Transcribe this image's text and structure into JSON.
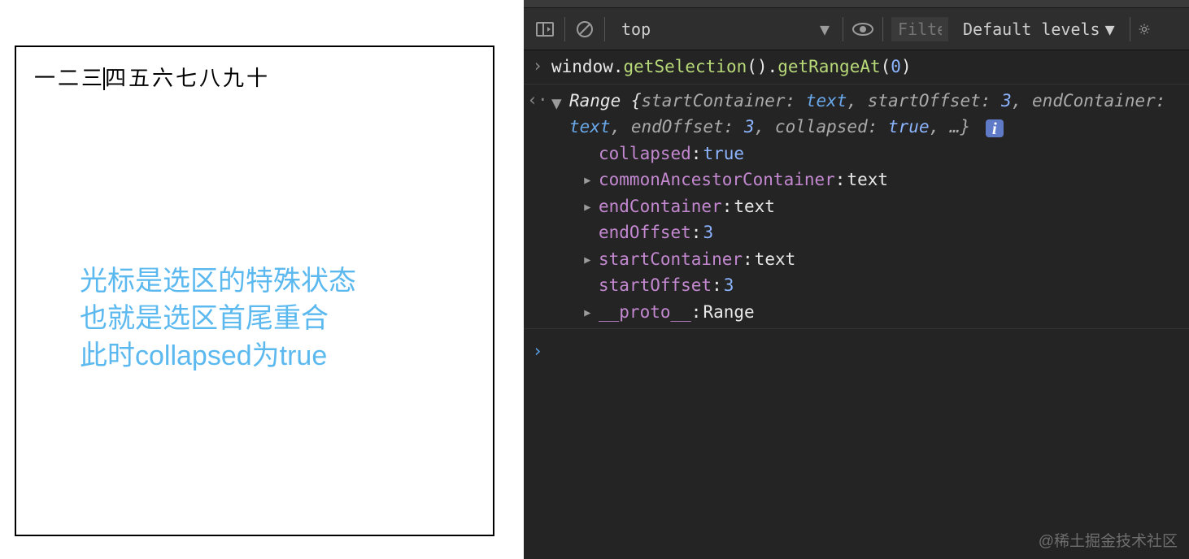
{
  "page": {
    "text_before_caret": "一二三",
    "text_after_caret": "四五六七八九十",
    "annotation_line1": "光标是选区的特殊状态",
    "annotation_line2": "也就是选区首尾重合",
    "annotation_line3": "此时collapsed为true"
  },
  "toolbar": {
    "context": "top",
    "filter_placeholder": "Filter",
    "levels_label": "Default levels"
  },
  "console": {
    "input": {
      "obj": "window",
      "dot1": ".",
      "m1": "getSelection",
      "p1": "()",
      "dot2": ".",
      "m2": "getRangeAt",
      "paren_open": "(",
      "arg": "0",
      "paren_close": ")"
    },
    "result_header": {
      "type": "Range",
      "brace_open": " {",
      "pairs": [
        {
          "k": "startContainer",
          "v": "text",
          "t": "val"
        },
        {
          "k": "startOffset",
          "v": "3",
          "t": "num"
        },
        {
          "k": "endContainer",
          "v": "text",
          "t": "val"
        },
        {
          "k": "endOffset",
          "v": "3",
          "t": "num"
        },
        {
          "k": "collapsed",
          "v": "true",
          "t": "bool"
        }
      ],
      "ellipsis": ", …}",
      "info": "i"
    },
    "props": [
      {
        "expandable": false,
        "k": "collapsed",
        "v": "true",
        "vclass": "c-bool2"
      },
      {
        "expandable": true,
        "k": "commonAncestorContainer",
        "v": "text",
        "vclass": "c-text"
      },
      {
        "expandable": true,
        "k": "endContainer",
        "v": "text",
        "vclass": "c-text"
      },
      {
        "expandable": false,
        "k": "endOffset",
        "v": "3",
        "vclass": "c-val2"
      },
      {
        "expandable": true,
        "k": "startContainer",
        "v": "text",
        "vclass": "c-text"
      },
      {
        "expandable": false,
        "k": "startOffset",
        "v": "3",
        "vclass": "c-val2"
      },
      {
        "expandable": true,
        "k": "__proto__",
        "v": "Range",
        "vclass": "c-text",
        "kclass": "c-proto"
      }
    ]
  },
  "watermark": "@稀土掘金技术社区"
}
